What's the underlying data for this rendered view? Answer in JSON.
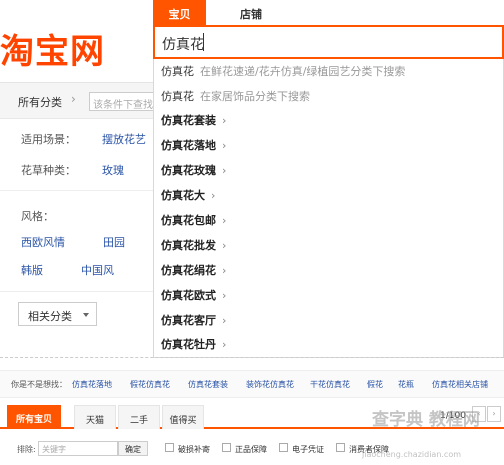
{
  "logo": {
    "text": "淘宝网"
  },
  "category_bar": {
    "label": "所有分类",
    "filter_placeholder": "该条件下查找"
  },
  "attributes": {
    "scene_label": "适用场景：",
    "scene_value": "摆放花艺",
    "species_label": "花草种类：",
    "species_value": "玫瑰",
    "style_label": "风格：",
    "styles": [
      "西欧风情",
      "田园",
      "韩版",
      "中国风"
    ]
  },
  "related_button": {
    "label": "相关分类"
  },
  "search": {
    "tab_active": "宝贝",
    "tab_inactive": "店铺",
    "query": "仿真花"
  },
  "suggestions": [
    {
      "keyword": "仿真花",
      "bold": "",
      "hint": "在鲜花速递/花卉仿真/绿植园艺分类下搜索"
    },
    {
      "keyword": "仿真花",
      "bold": "",
      "hint": "在家居饰品分类下搜索"
    },
    {
      "keyword": "仿真花",
      "bold": "套装",
      "arrow": "›"
    },
    {
      "keyword": "仿真花",
      "bold": "落地",
      "arrow": "›"
    },
    {
      "keyword": "仿真花",
      "bold": "玫瑰",
      "arrow": "›"
    },
    {
      "keyword": "仿真花",
      "bold": "大",
      "arrow": "›"
    },
    {
      "keyword": "仿真花",
      "bold": "包邮",
      "arrow": "›"
    },
    {
      "keyword": "仿真花",
      "bold": "批发",
      "arrow": "›"
    },
    {
      "keyword": "仿真花",
      "bold": "绢花",
      "arrow": "›"
    },
    {
      "keyword": "仿真花",
      "bold": "欧式",
      "arrow": "›"
    },
    {
      "keyword": "仿真花",
      "bold": "客厅",
      "arrow": "›"
    },
    {
      "keyword": "仿真花",
      "bold": "牡丹",
      "arrow": "›"
    }
  ],
  "guess": {
    "label": "你是不是想找：",
    "links": [
      "仿真花落地",
      "假花仿真花",
      "仿真花套装",
      "装饰花仿真花",
      "干花仿真花",
      "假花",
      "花瓶",
      "仿真花相关店铺"
    ]
  },
  "result_tabs": [
    "所有宝贝",
    "天猫",
    "二手",
    "值得买"
  ],
  "pager": {
    "text": "1/100",
    "prev": "‹",
    "next": "›"
  },
  "filters": {
    "exclude_label": "排除:",
    "exclude_placeholder": "关键字",
    "ok": "确定",
    "options": [
      "破损补寄",
      "正品保障",
      "电子凭证",
      "消费者保障"
    ]
  },
  "watermark": {
    "main": "查字典 教程网",
    "sub": "jiaocheng.chazidian.com"
  },
  "colors": {
    "accent": "#ff5500",
    "link": "#2953a6"
  }
}
